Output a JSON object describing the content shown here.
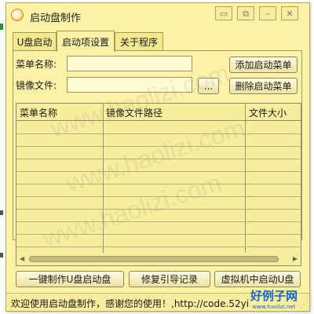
{
  "window": {
    "title": "启动盘制作",
    "controls": [
      "chat-icon",
      "restore-icon",
      "minimize-icon",
      "close-icon"
    ]
  },
  "tabs": [
    {
      "label": "U盘启动",
      "active": false
    },
    {
      "label": "启动项设置",
      "active": true
    },
    {
      "label": "关于程序",
      "active": false
    }
  ],
  "form": {
    "menu_name_label": "菜单名称:",
    "menu_name_value": "",
    "image_file_label": "镜像文件:",
    "image_file_value": "",
    "browse_label": "...",
    "add_menu_label": "添加启动菜单",
    "delete_menu_label": "删除启动菜单"
  },
  "table": {
    "columns": [
      "菜单名称",
      "镜像文件路径",
      "文件大小"
    ],
    "rows": []
  },
  "actions": {
    "make_usb_label": "一键制作U盘启动盘",
    "repair_boot_label": "修复引导记录",
    "vm_boot_label": "虚拟机中启动U盘"
  },
  "status": {
    "text": "欢迎使用启动盘制作，感谢您的使用！,http://code.52yi"
  },
  "logo": {
    "main": "好例子网",
    "sub": "www.haolizi.net"
  },
  "watermark": "www.haolizi.com",
  "colors": {
    "window_bg": "#fbf2a8",
    "border": "#a69a55",
    "logo_blue": "#1b66c9"
  }
}
